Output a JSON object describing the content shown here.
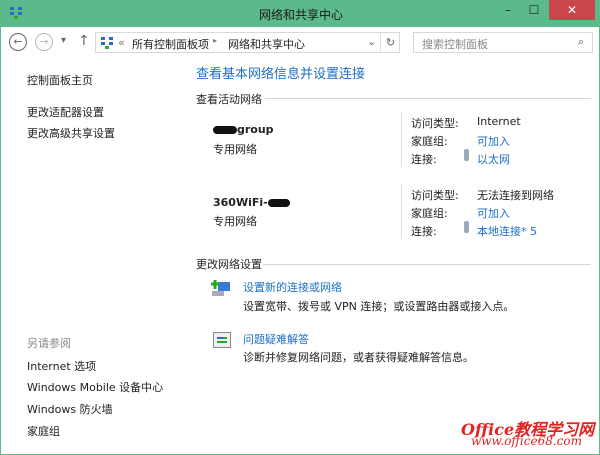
{
  "window": {
    "title": "网络和共享中心",
    "minimize": "–",
    "maximize": "☐",
    "close": "✕"
  },
  "toolbar": {
    "back": "←",
    "forward": "→",
    "recent": "▾",
    "up": "↑",
    "breadcrumb": [
      "«",
      "所有控制面板项",
      "▸",
      "网络和共享中心"
    ],
    "dropdown": "⌄",
    "refresh": "↻",
    "search_placeholder": "搜索控制面板",
    "search_icon": "⌕"
  },
  "sidebar": {
    "items": [
      "控制面板主页",
      "更改适配器设置",
      "更改高级共享设置"
    ],
    "see_also": "另请参阅",
    "see_also_items": [
      "Internet 选项",
      "Windows Mobile 设备中心",
      "Windows 防火墙",
      "家庭组"
    ]
  },
  "main": {
    "title": "查看基本网络信息并设置连接",
    "active_header": "查看活动网络",
    "networks": [
      {
        "name": "group",
        "type": "专用网络",
        "access_label": "访问类型:",
        "access": "Internet",
        "homegroup_label": "家庭组:",
        "homegroup": "可加入",
        "conn_label": "连接:",
        "conn": "以太网"
      },
      {
        "name": "360WiFi-",
        "type": "专用网络",
        "access_label": "访问类型:",
        "access": "无法连接到网络",
        "homegroup_label": "家庭组:",
        "homegroup": "可加入",
        "conn_label": "连接:",
        "conn": "本地连接* 5"
      }
    ],
    "change_header": "更改网络设置",
    "tasks": [
      {
        "link": "设置新的连接或网络",
        "desc": "设置宽带、拨号或 VPN 连接；或设置路由器或接入点。"
      },
      {
        "link": "问题疑难解答",
        "desc": "诊断并修复网络问题，或者获得疑难解答信息。"
      }
    ]
  },
  "watermark": {
    "line1": "Office教程学习网",
    "line2": "www.office68.com"
  },
  "colors": {
    "titlebar": "#5cb98b",
    "link": "#1e6fc8",
    "close": "#c9464a"
  }
}
